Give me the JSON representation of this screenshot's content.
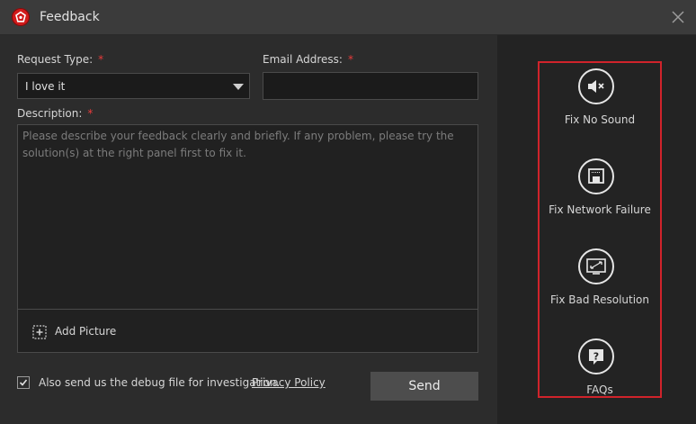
{
  "window": {
    "title": "Feedback"
  },
  "form": {
    "request_type_label": "Request Type:",
    "request_type_value": "I love it",
    "email_label": "Email Address:",
    "email_value": "",
    "required_mark": "*",
    "description_label": "Description:",
    "description_placeholder": "Please describe your feedback clearly and briefly. If any problem, please try the solution(s) at the right panel first to fix it.",
    "add_picture_label": "Add Picture",
    "debug_checkbox_checked": true,
    "debug_checkbox_label": "Also send us the debug file for investigation.",
    "privacy_link": "Privacy Policy",
    "send_label": "Send"
  },
  "fixes": [
    {
      "label": "Fix No Sound",
      "icon": "speaker-mute-icon"
    },
    {
      "label": "Fix Network Failure",
      "icon": "network-port-icon"
    },
    {
      "label": "Fix Bad Resolution",
      "icon": "monitor-resolution-icon"
    },
    {
      "label": "FAQs",
      "icon": "question-icon"
    }
  ],
  "colors": {
    "accent_red": "#d0232b",
    "background": "#2c2c2c",
    "right_panel": "#232323"
  }
}
